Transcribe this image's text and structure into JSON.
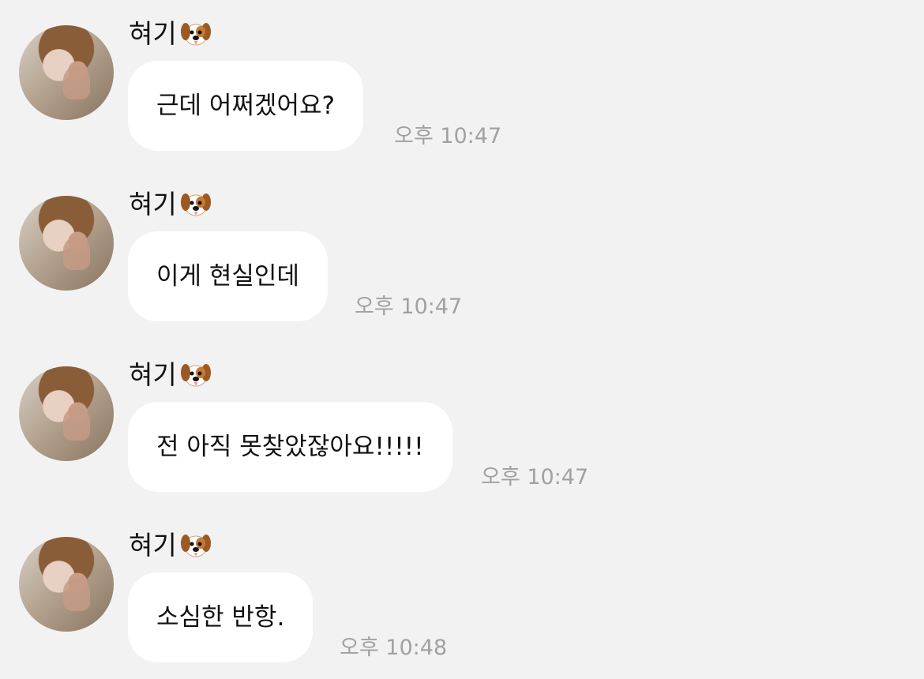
{
  "messages": [
    {
      "sender": "혀기",
      "sender_emoji": "dog-face-icon",
      "text": "근데 어쩌겠어요?",
      "time": "오후 10:47"
    },
    {
      "sender": "혀기",
      "sender_emoji": "dog-face-icon",
      "text": "이게 현실인데",
      "time": "오후 10:47"
    },
    {
      "sender": "혀기",
      "sender_emoji": "dog-face-icon",
      "text": "전 아직 못찾았잖아요!!!!!",
      "time": "오후 10:47"
    },
    {
      "sender": "혀기",
      "sender_emoji": "dog-face-icon",
      "text": "소심한 반항.",
      "time": "오후 10:48"
    }
  ],
  "colors": {
    "background": "#f2f2f2",
    "bubble": "#ffffff",
    "timestamp": "#a1a1a1",
    "text": "#111111"
  }
}
